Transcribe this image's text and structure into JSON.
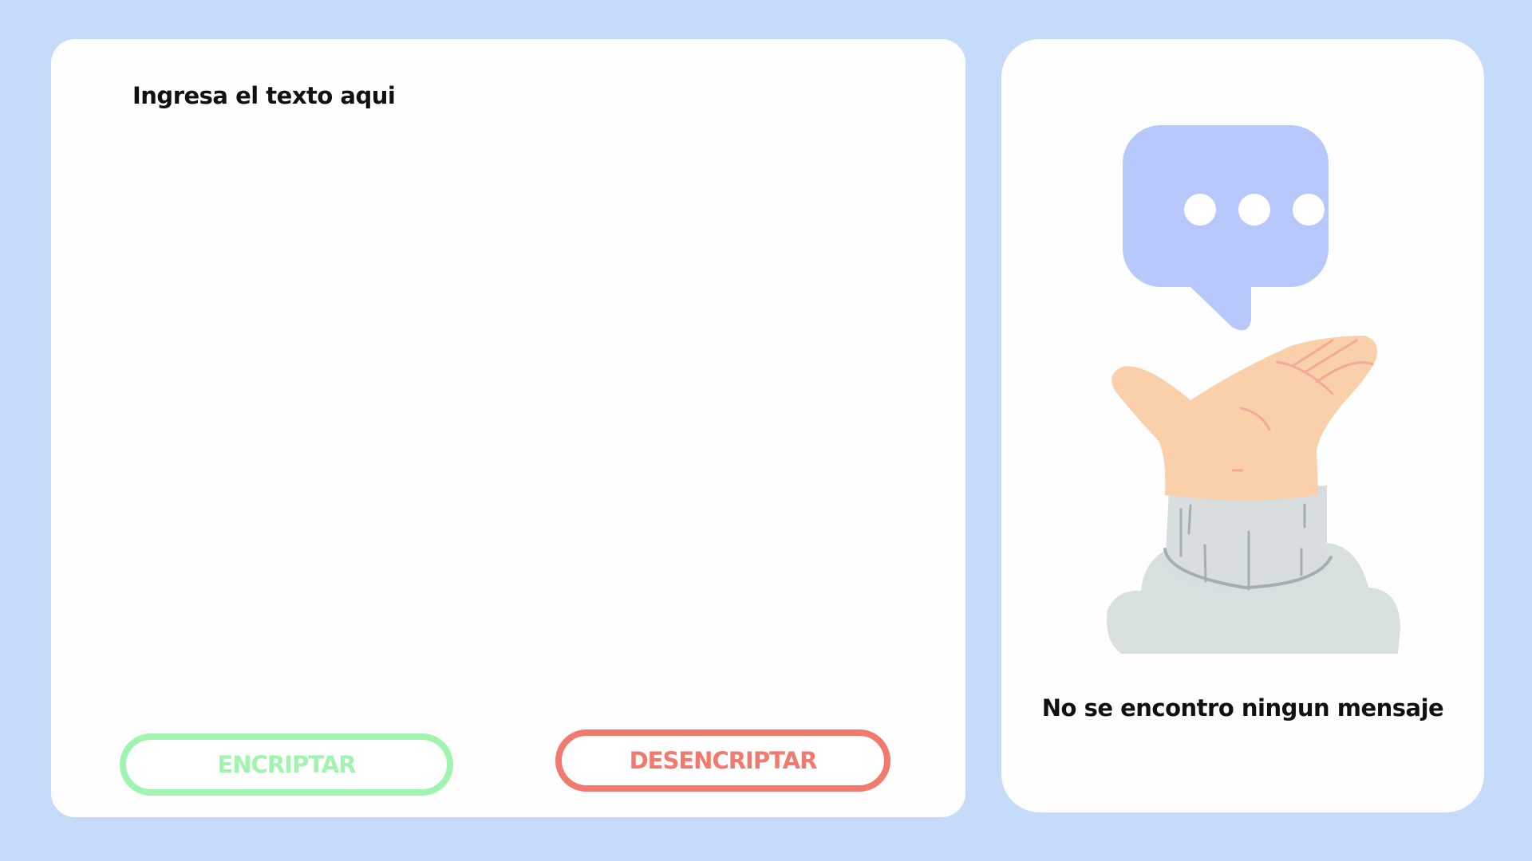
{
  "input": {
    "placeholder": "Ingresa el texto aqui",
    "value": ""
  },
  "buttons": {
    "encrypt_label": "ENCRIPTAR",
    "decrypt_label": "DESENCRIPTAR"
  },
  "output": {
    "empty_message": "No se encontro ningun mensaje",
    "illustration": "hand-with-speech-bubble"
  },
  "colors": {
    "background": "#c5dbf9",
    "panel": "#fefefe",
    "encrypt_accent": "#a1f4b0",
    "decrypt_accent": "#f1796d",
    "bubble": "#b8c8fd"
  }
}
